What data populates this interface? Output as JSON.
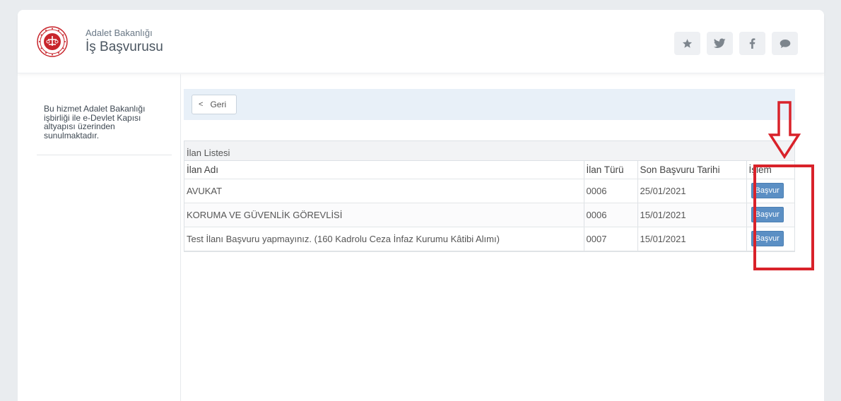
{
  "header": {
    "brand_small": "Adalet Bakanlığı",
    "brand_big": "İş Başvurusu",
    "icons": [
      "star-icon",
      "twitter-icon",
      "facebook-icon",
      "chat-bubble-icon"
    ]
  },
  "sidebar": {
    "text": "Bu hizmet Adalet Bakanlığı işbirliği ile e-Devlet Kapısı altyapısı üzerinden sunulmaktadır."
  },
  "backbar": {
    "back_label": "Geri"
  },
  "table": {
    "caption": "İlan Listesi",
    "headers": [
      "İlan Adı",
      "İlan Türü",
      "Son Başvuru Tarihi",
      "İşlem"
    ],
    "rows": [
      {
        "name": "AVUKAT",
        "type": "0006",
        "deadline": "25/01/2021",
        "action": "Başvur"
      },
      {
        "name": "KORUMA VE GÜVENLİK GÖREVLİSİ",
        "type": "0006",
        "deadline": "15/01/2021",
        "action": "Başvur"
      },
      {
        "name": "Test İlanı Başvuru yapmayınız. (160 Kadrolu Ceza İnfaz Kurumu Kâtibi Alımı)",
        "type": "0007",
        "deadline": "15/01/2021",
        "action": "Başvur"
      }
    ]
  },
  "colors": {
    "accent_red": "#d9222a",
    "button_blue": "#5b8fc4",
    "backbar_bg": "#e8f0f8"
  }
}
